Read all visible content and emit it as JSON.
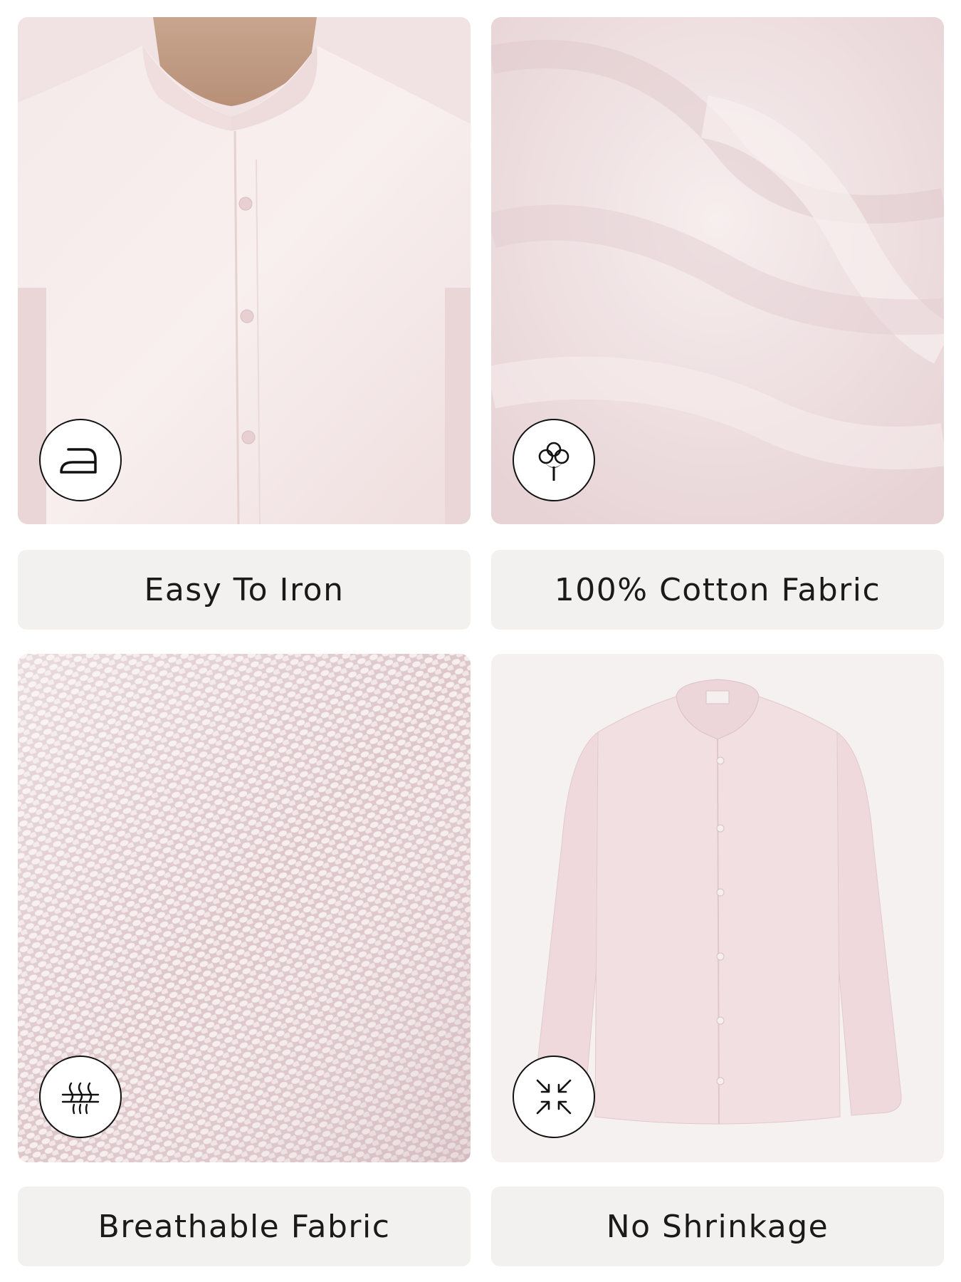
{
  "features": [
    {
      "label": "Easy To Iron",
      "icon": "iron-icon"
    },
    {
      "label": "100% Cotton Fabric",
      "icon": "cotton-flower-icon"
    },
    {
      "label": "Breathable Fabric",
      "icon": "breathable-fabric-icon"
    },
    {
      "label": "No Shrinkage",
      "icon": "no-shrinkage-icon"
    }
  ],
  "colors": {
    "fabric_pink": "#f3e4e4",
    "label_bg": "#f3f1ef",
    "text": "#1a1a1a"
  }
}
